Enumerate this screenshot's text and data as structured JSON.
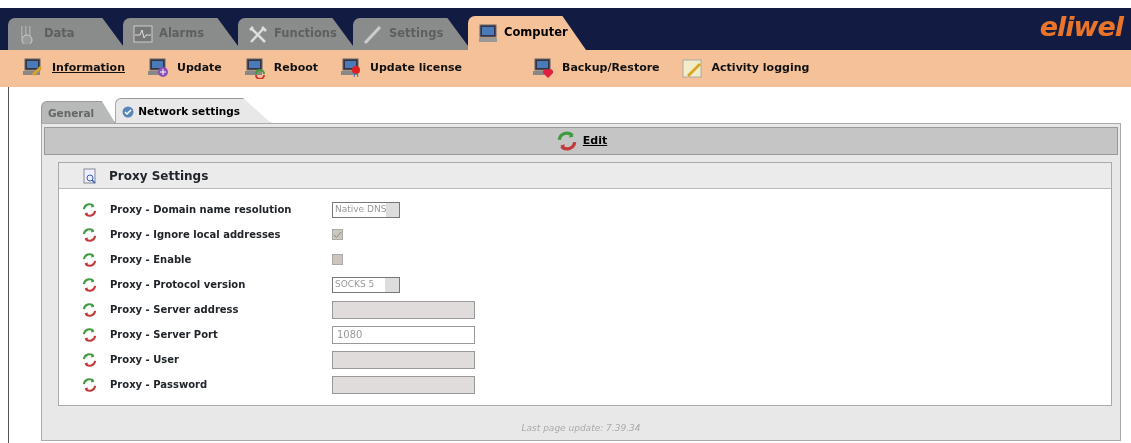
{
  "logo": "eliwel",
  "tabs": [
    {
      "label": "Data",
      "selected": false
    },
    {
      "label": "Alarms",
      "selected": false
    },
    {
      "label": "Functions",
      "selected": false
    },
    {
      "label": "Settings",
      "selected": false
    },
    {
      "label": "Computer",
      "selected": true
    }
  ],
  "toolbar": [
    {
      "label": "Information",
      "selected": true
    },
    {
      "label": "Update",
      "selected": false
    },
    {
      "label": "Reboot",
      "selected": false
    },
    {
      "label": "Update license",
      "selected": false
    },
    {
      "label": "Backup/Restore",
      "selected": false
    },
    {
      "label": "Activity logging",
      "selected": false
    }
  ],
  "subtabs": [
    {
      "label": "General",
      "selected": false
    },
    {
      "label": "Network settings",
      "selected": true
    }
  ],
  "edit_button": "Edit",
  "section": {
    "title": "Proxy Settings",
    "rows": [
      {
        "label": "Proxy - Domain name resolution",
        "kind": "select",
        "value": "Native DNS"
      },
      {
        "label": "Proxy - Ignore local addresses",
        "kind": "checkbox",
        "checked": true
      },
      {
        "label": "Proxy - Enable",
        "kind": "checkbox",
        "checked": false
      },
      {
        "label": "Proxy - Protocol version",
        "kind": "select",
        "value": "SOCKS 5"
      },
      {
        "label": "Proxy - Server address",
        "kind": "text",
        "disabled": true
      },
      {
        "label": "Proxy - Server Port",
        "kind": "text",
        "disabled": false,
        "value": "1080"
      },
      {
        "label": "Proxy - User",
        "kind": "text",
        "disabled": true
      },
      {
        "label": "Proxy - Password",
        "kind": "text",
        "disabled": true
      }
    ]
  },
  "status_bar": "Last page update: 7.39.34"
}
